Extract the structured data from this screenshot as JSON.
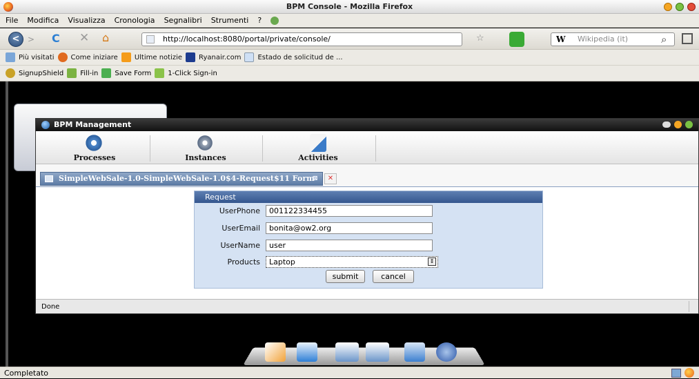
{
  "browser": {
    "window_title": "BPM Console - Mozilla Firefox",
    "menu": [
      "File",
      "Modifica",
      "Visualizza",
      "Cronologia",
      "Segnalibri",
      "Strumenti",
      "?"
    ],
    "url": "http://localhost:8080/portal/private/console/",
    "search_placeholder": "Wikipedia (it)",
    "search_engine": "W",
    "bookmarks": [
      "Più visitati",
      "Come iniziare",
      "Ultime notizie",
      "Ryanair.com",
      "Estado de solicitud de ..."
    ],
    "addon_toolbar": [
      "SignupShield",
      "Fill-in",
      "Save Form",
      "1-Click Sign-in"
    ],
    "status": "Completato"
  },
  "bpm": {
    "title": "BPM Management",
    "toolbar": [
      {
        "label": "Processes"
      },
      {
        "label": "Instances"
      },
      {
        "label": "Activities"
      }
    ],
    "tab_title": "SimpleWebSale-1.0-SimpleWebSale-1.0$4-Request$11 Form",
    "form": {
      "heading": "Request",
      "fields": [
        {
          "label": "UserPhone",
          "value": "001122334455"
        },
        {
          "label": "UserEmail",
          "value": "bonita@ow2.org"
        },
        {
          "label": "UserName",
          "value": "user"
        },
        {
          "label": "Products",
          "value": "Laptop"
        }
      ],
      "submit": "submit",
      "cancel": "cancel"
    },
    "status": "Done"
  }
}
